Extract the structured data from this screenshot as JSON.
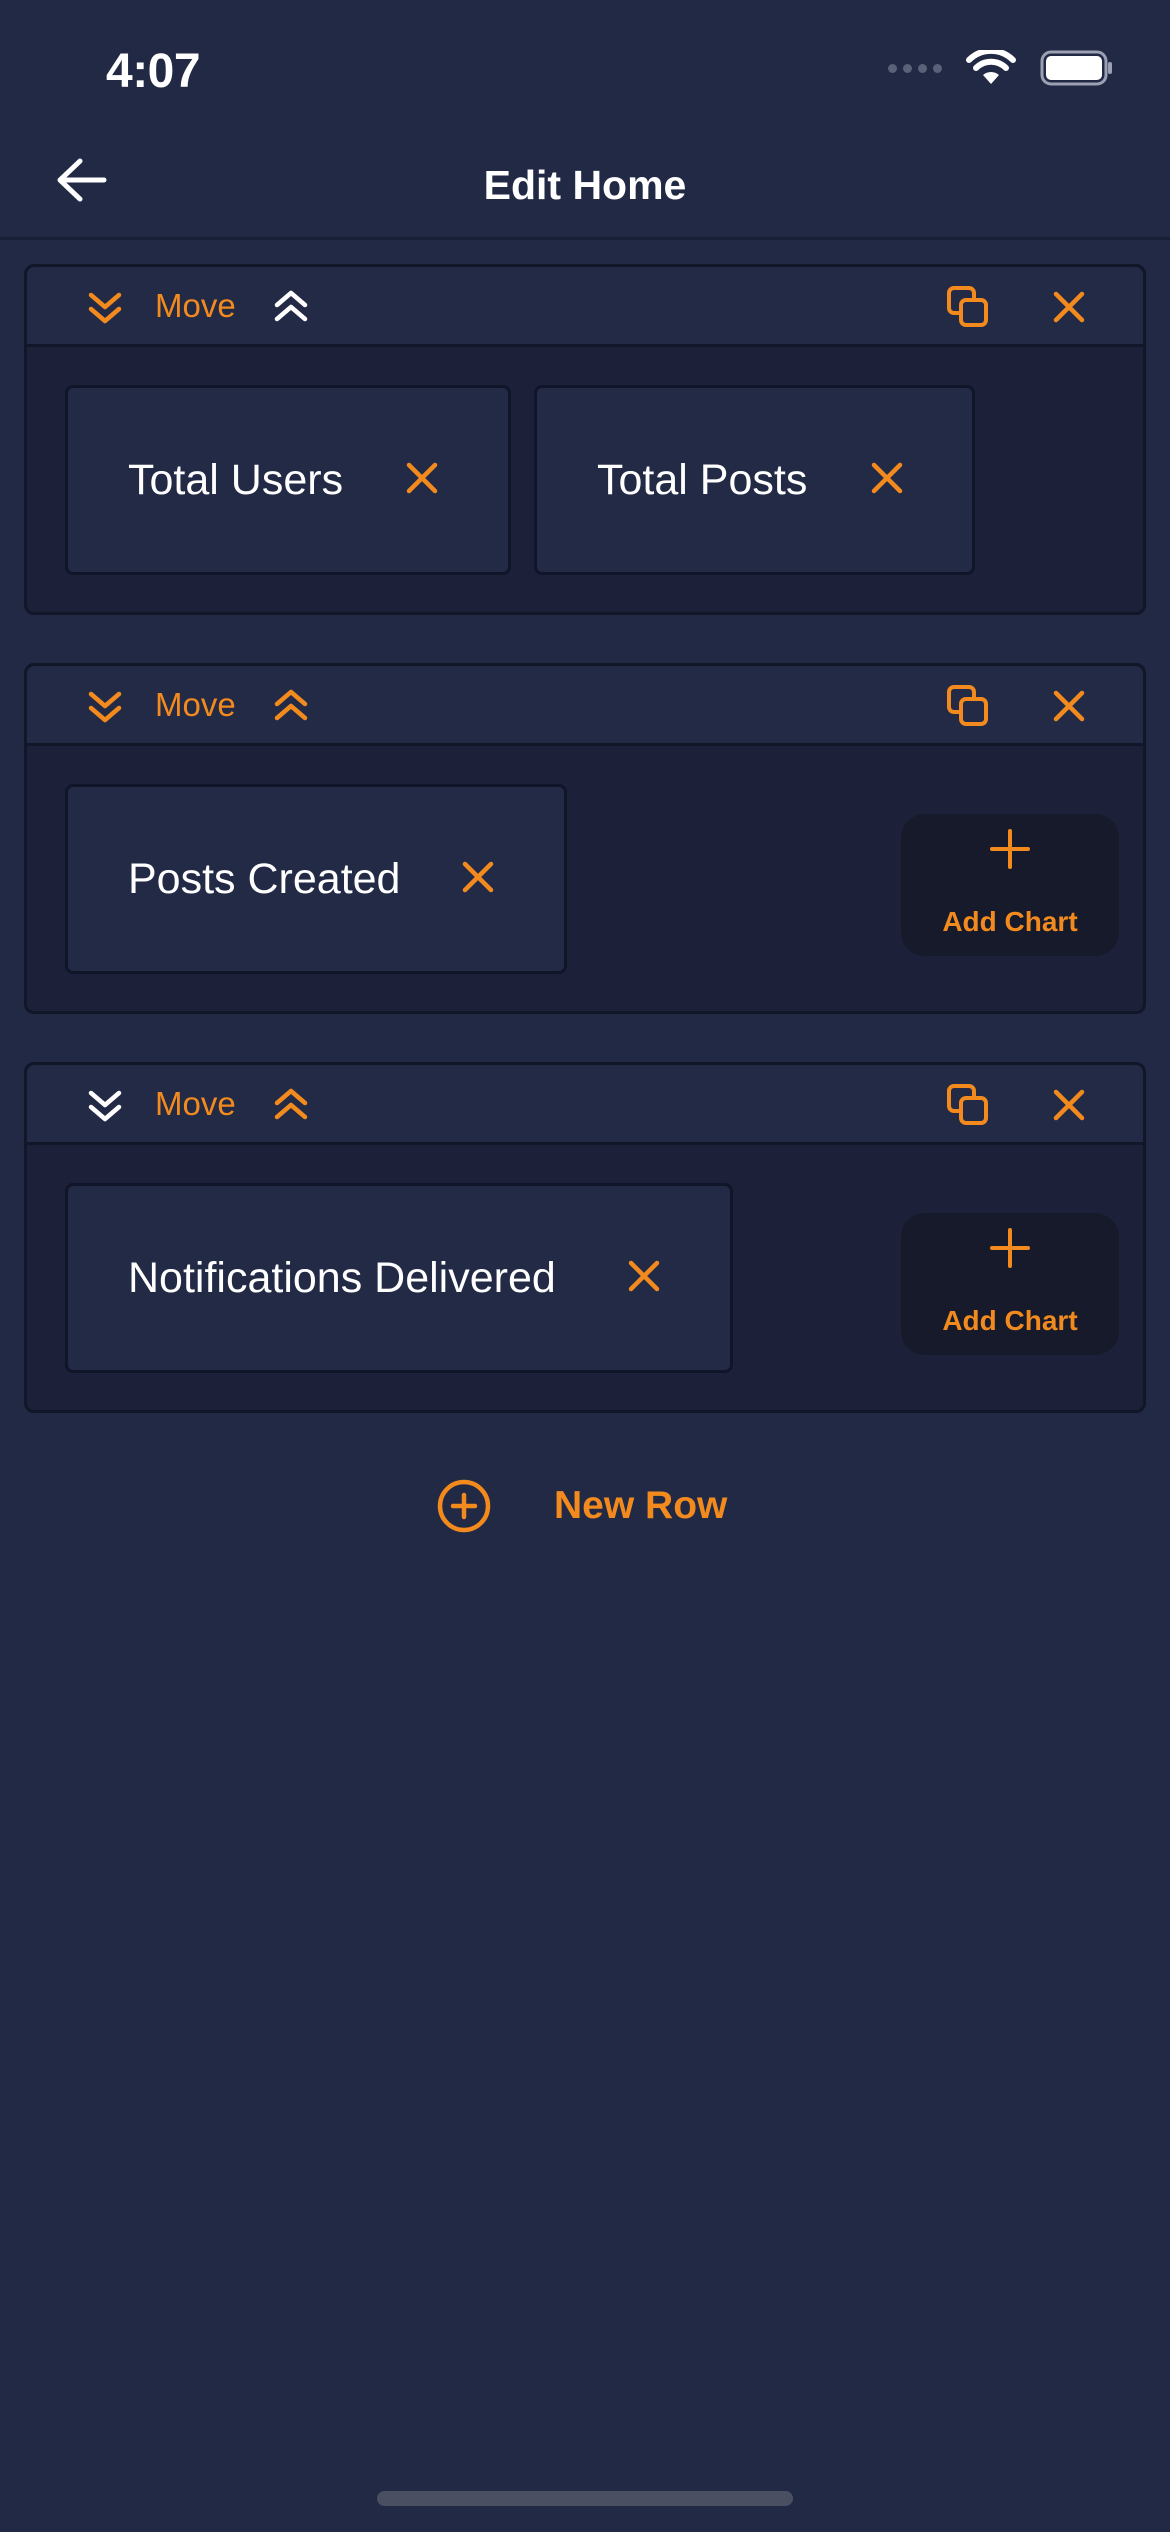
{
  "status_bar": {
    "time": "4:07",
    "icons": [
      "signal-icon",
      "wifi-icon",
      "battery-icon"
    ]
  },
  "nav": {
    "title": "Edit Home",
    "back_icon": "arrow-left-icon"
  },
  "colors": {
    "background": "#212944",
    "accent": "#f28a1e",
    "row_bg": "#1c2139",
    "card_bg": "#222a46",
    "add_bg": "#161a2b"
  },
  "rows": [
    {
      "move_label": "Move",
      "move_down_enabled": true,
      "move_up_enabled": false,
      "charts": [
        {
          "label": "Total Users"
        },
        {
          "label": "Total Posts"
        }
      ]
    },
    {
      "move_label": "Move",
      "move_down_enabled": true,
      "move_up_enabled": true,
      "charts": [
        {
          "label": "Posts Created"
        }
      ],
      "add_chart_label": "Add Chart"
    },
    {
      "move_label": "Move",
      "move_down_enabled": false,
      "move_up_enabled": true,
      "charts": [
        {
          "label": "Notifications Delivered"
        }
      ],
      "add_chart_label": "Add Chart"
    }
  ],
  "new_row_label": "New Row"
}
